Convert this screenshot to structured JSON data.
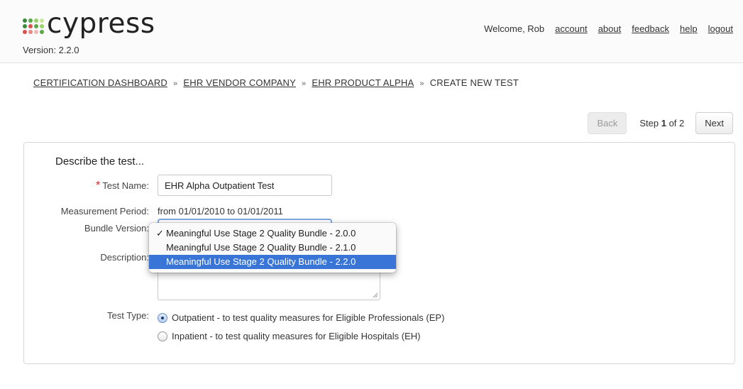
{
  "app": {
    "logo_text": "cypress",
    "version": "Version: 2.2.0",
    "colors": {
      "logo_dot_dark": "#3d8a3a",
      "logo_dot_light": "#9bd16a",
      "logo_dot_red": "#d9534f",
      "highlight": "#3875d7"
    }
  },
  "topnav": {
    "welcome": "Welcome, Rob",
    "links": [
      "account",
      "about",
      "feedback",
      "help",
      "logout"
    ]
  },
  "breadcrumb": {
    "items": [
      "CERTIFICATION DASHBOARD",
      "EHR VENDOR COMPANY",
      "EHR PRODUCT ALPHA",
      "CREATE NEW TEST"
    ],
    "separator": "»"
  },
  "wizard": {
    "back_label": "Back",
    "step_prefix": "Step ",
    "step_current": "1",
    "step_suffix": " of 2",
    "next_label": "Next"
  },
  "form": {
    "title": "Describe the test...",
    "required_marker": "*",
    "test_name_label": "Test Name:",
    "test_name_value": "EHR Alpha Outpatient Test",
    "measurement_period_label": "Measurement Period:",
    "measurement_period_value": "from 01/01/2010 to 01/01/2011",
    "bundle_version_label": "Bundle Version:",
    "description_label": "Description:",
    "test_type_label": "Test Type:",
    "test_type_options": [
      {
        "label": "Outpatient - to test quality measures for Eligible Professionals (EP)",
        "checked": true
      },
      {
        "label": "Inpatient - to test quality measures for Eligible Hospitals (EH)",
        "checked": false
      }
    ]
  },
  "bundle_dropdown": {
    "check_mark": "✓",
    "options": [
      {
        "label": "Meaningful Use Stage 2 Quality Bundle - 2.0.0",
        "selected": true,
        "highlighted": false
      },
      {
        "label": "Meaningful Use Stage 2 Quality Bundle - 2.1.0",
        "selected": false,
        "highlighted": false
      },
      {
        "label": "Meaningful Use Stage 2 Quality Bundle - 2.2.0",
        "selected": false,
        "highlighted": true
      }
    ]
  }
}
